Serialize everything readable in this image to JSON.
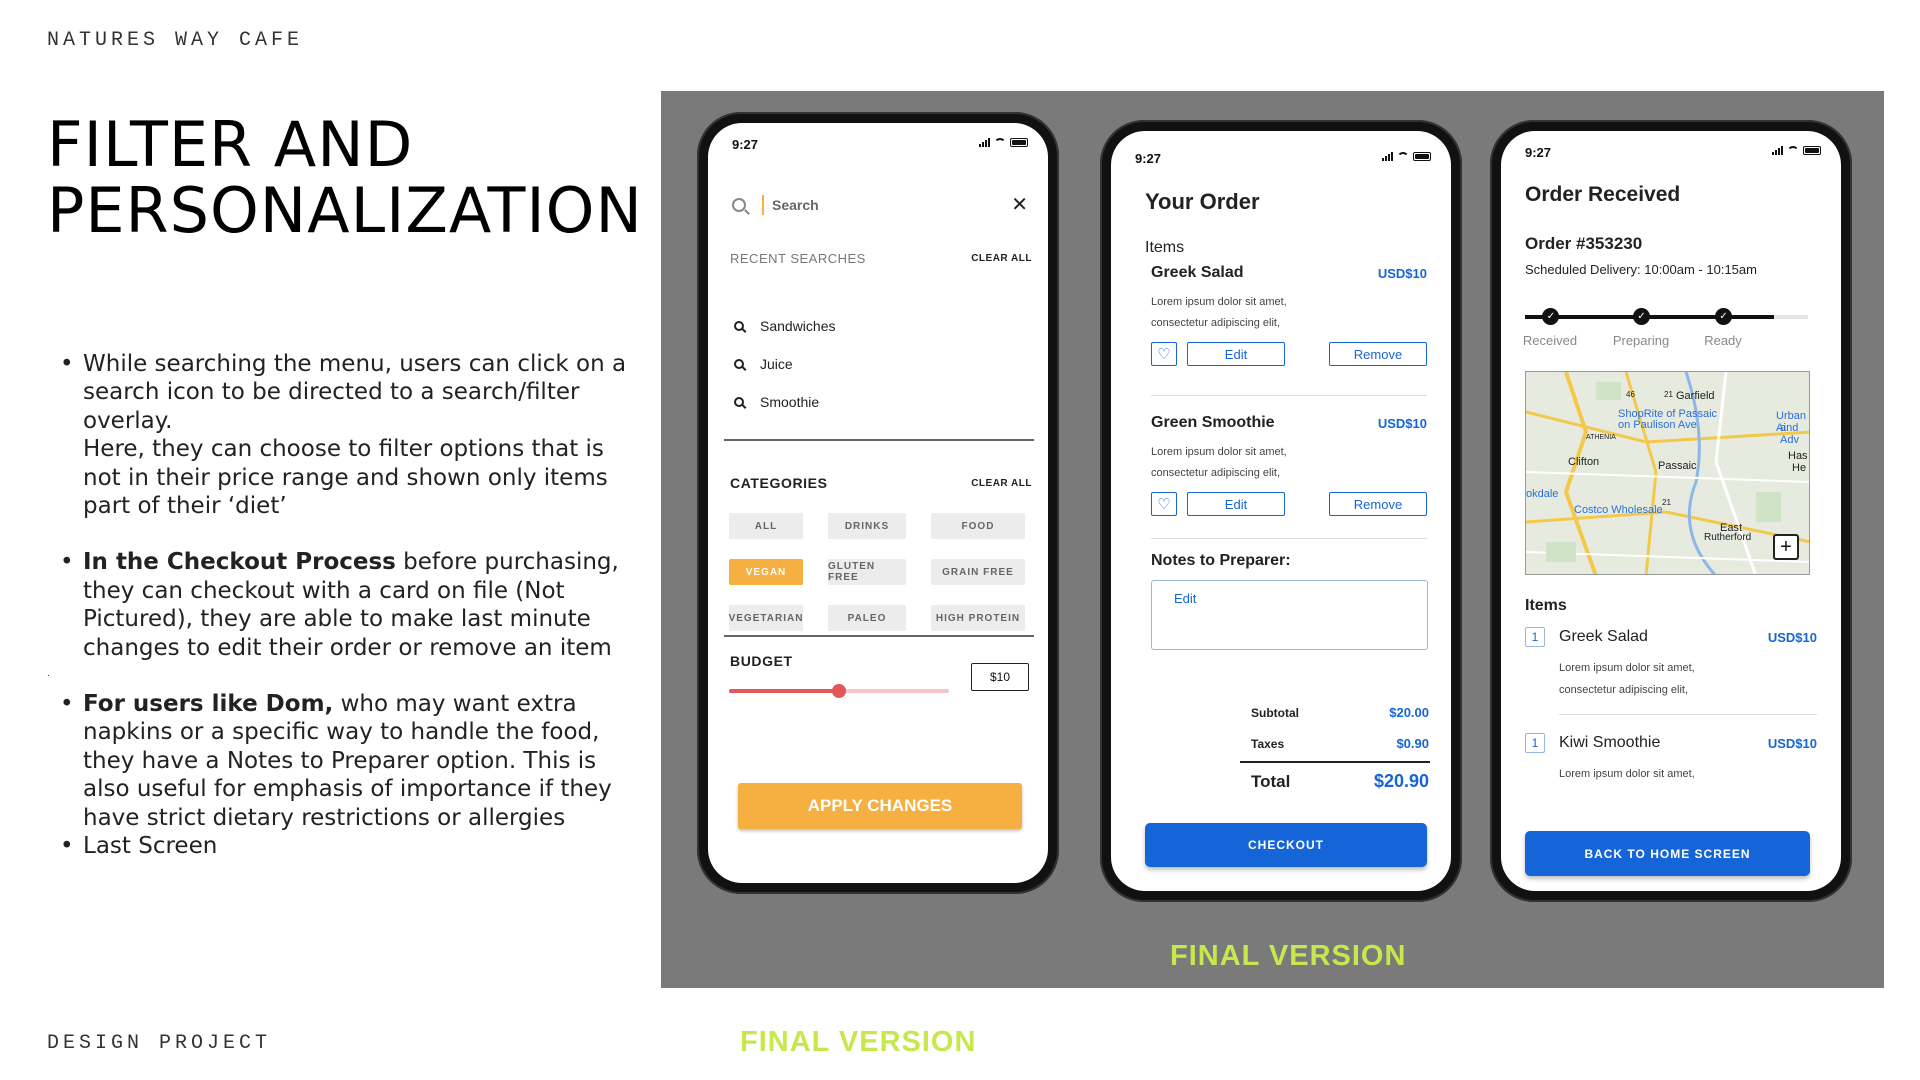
{
  "brand": "NATURES WAY CAFE",
  "title_line1": "FILTER AND",
  "title_line2": "PERSONALIZATION",
  "bullets": {
    "b1_l1": "While searching the menu, users can click on a",
    "b1_l2": "search icon to be directed to a search/filter",
    "b1_l3": "overlay.",
    "b1_l4": "Here, they can choose to filter options that is",
    "b1_l5": "not in their price range and shown only items",
    "b1_l6": "part of their ‘diet’",
    "b2_bold": "In the Checkout Process",
    "b2_l1_rest": " before purchasing,",
    "b2_l2": "they can checkout with a card on file (Not",
    "b2_l3": "Pictured), they are able to make last minute",
    "b2_l4": "changes to edit their order or remove an item",
    "stray": ".",
    "b3_bold": "For users like Dom,",
    "b3_l1_rest": " who may want extra",
    "b3_l2": "napkins or a specific way to handle the food,",
    "b3_l3": "they have a Notes to Preparer option. This is",
    "b3_l4": "also useful for emphasis of importance if they",
    "b3_l5": "have strict dietary restrictions or allergies",
    "b4": "Last Screen"
  },
  "panel_label": "FINAL VERSION",
  "below_label": "FINAL VERSION",
  "footer": "DESIGN PROJECT",
  "search_screen": {
    "time": "9:27",
    "search_placeholder": "Search",
    "recent_header": "RECENT SEARCHES",
    "clear_all": "CLEAR ALL",
    "recent": [
      "Sandwiches",
      "Juice",
      "Smoothie"
    ],
    "categories_header": "CATEGORIES",
    "categories": [
      "ALL",
      "DRINKS",
      "FOOD",
      "VEGAN",
      "GLUTEN FREE",
      "GRAIN FREE",
      "VEGETARIAN",
      "PALEO",
      "HIGH PROTEIN"
    ],
    "selected_category": "VEGAN",
    "budget_header": "BUDGET",
    "budget_value": "$10",
    "budget_level": 0.5,
    "apply": "APPLY CHANGES",
    "accent": "#f5b041"
  },
  "order_screen": {
    "time": "9:27",
    "title": "Your Order",
    "items_label": "Items",
    "items": [
      {
        "name": "Greek Salad",
        "price": "USD$10",
        "desc1": "Lorem ipsum dolor sit amet,",
        "desc2": "consectetur adipiscing elit,"
      },
      {
        "name": "Green Smoothie",
        "price": "USD$10",
        "desc1": "Lorem ipsum dolor sit amet,",
        "desc2": "consectetur adipiscing elit,"
      }
    ],
    "edit": "Edit",
    "remove": "Remove",
    "notes_label": "Notes to Preparer:",
    "notes_value": "Edit",
    "subtotal_label": "Subtotal",
    "subtotal": "$20.00",
    "taxes_label": "Taxes",
    "taxes": "$0.90",
    "total_label": "Total",
    "total": "$20.90",
    "checkout": "CHECKOUT",
    "accent": "#1565d8"
  },
  "received_screen": {
    "time": "9:27",
    "title": "Order Received",
    "order_number": "Order #353230",
    "schedule": "Scheduled Delivery: 10:00am - 10:15am",
    "steps": [
      "Received",
      "Preparing",
      "Ready"
    ],
    "map_labels": [
      "Garfield",
      "ShopRite of Passaic",
      "on Paulison Ave",
      "Urban Ai",
      "and Adv",
      "ATHENIA",
      "Clifton",
      "Passaic",
      "Has",
      "He",
      "okdale",
      "Costco Wholesale",
      "East",
      "Rutherford",
      "46",
      "21",
      "21"
    ],
    "items_label": "Items",
    "items": [
      {
        "qty": "1",
        "name": "Greek Salad",
        "price": "USD$10",
        "desc1": "Lorem ipsum dolor sit amet,",
        "desc2": "consectetur adipiscing elit,"
      },
      {
        "qty": "1",
        "name": "Kiwi Smoothie",
        "price": "USD$10",
        "desc1": "Lorem ipsum dolor sit amet,"
      }
    ],
    "home_button": "BACK TO HOME SCREEN"
  }
}
